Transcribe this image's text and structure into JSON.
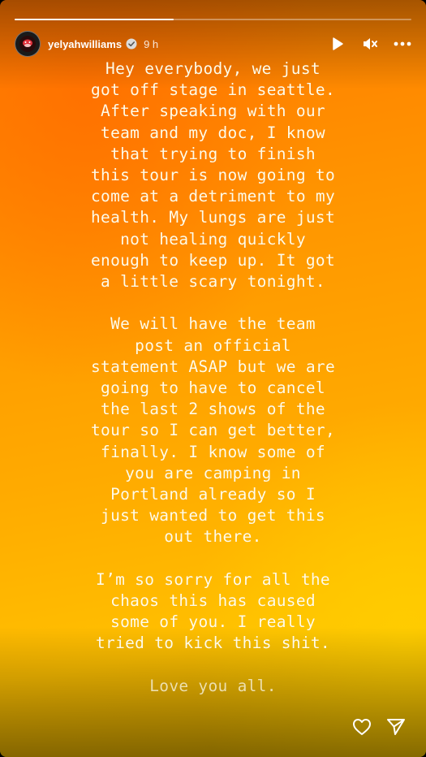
{
  "story": {
    "progress_fraction": 0.4,
    "user": {
      "username": "yelyahwilliams",
      "verified": true,
      "posted_ago": "9 h",
      "avatar_icon": "avatar-image"
    },
    "controls": {
      "play_icon": "play-icon",
      "mute_icon": "muted-speaker-icon",
      "more_icon": "more-options-icon"
    },
    "paragraphs": [
      "Hey everybody, we just\ngot off stage in seattle.\nAfter speaking with our\nteam and my doc, I know\nthat trying to finish\nthis tour is now going to\ncome at a detriment to my\nhealth. My lungs are just\nnot healing quickly\nenough to keep up. It got\na little scary tonight.",
      "We will have the team\npost an official\nstatement ASAP but we are\ngoing to have to cancel\nthe last 2 shows of the\ntour so I can get better,\nfinally. I know some of\nyou are camping in\nPortland already so I\njust wanted to get this\nout there.",
      "I’m so sorry for all the\nchaos this has caused\nsome of you. I really\ntried to kick this shit.",
      "Love you all."
    ],
    "actions": {
      "like_icon": "heart-icon",
      "share_icon": "send-icon"
    },
    "colors": {
      "accent_orange": "#ff8a00",
      "accent_yellow": "#ffc400",
      "text": "#fffbe8"
    }
  }
}
